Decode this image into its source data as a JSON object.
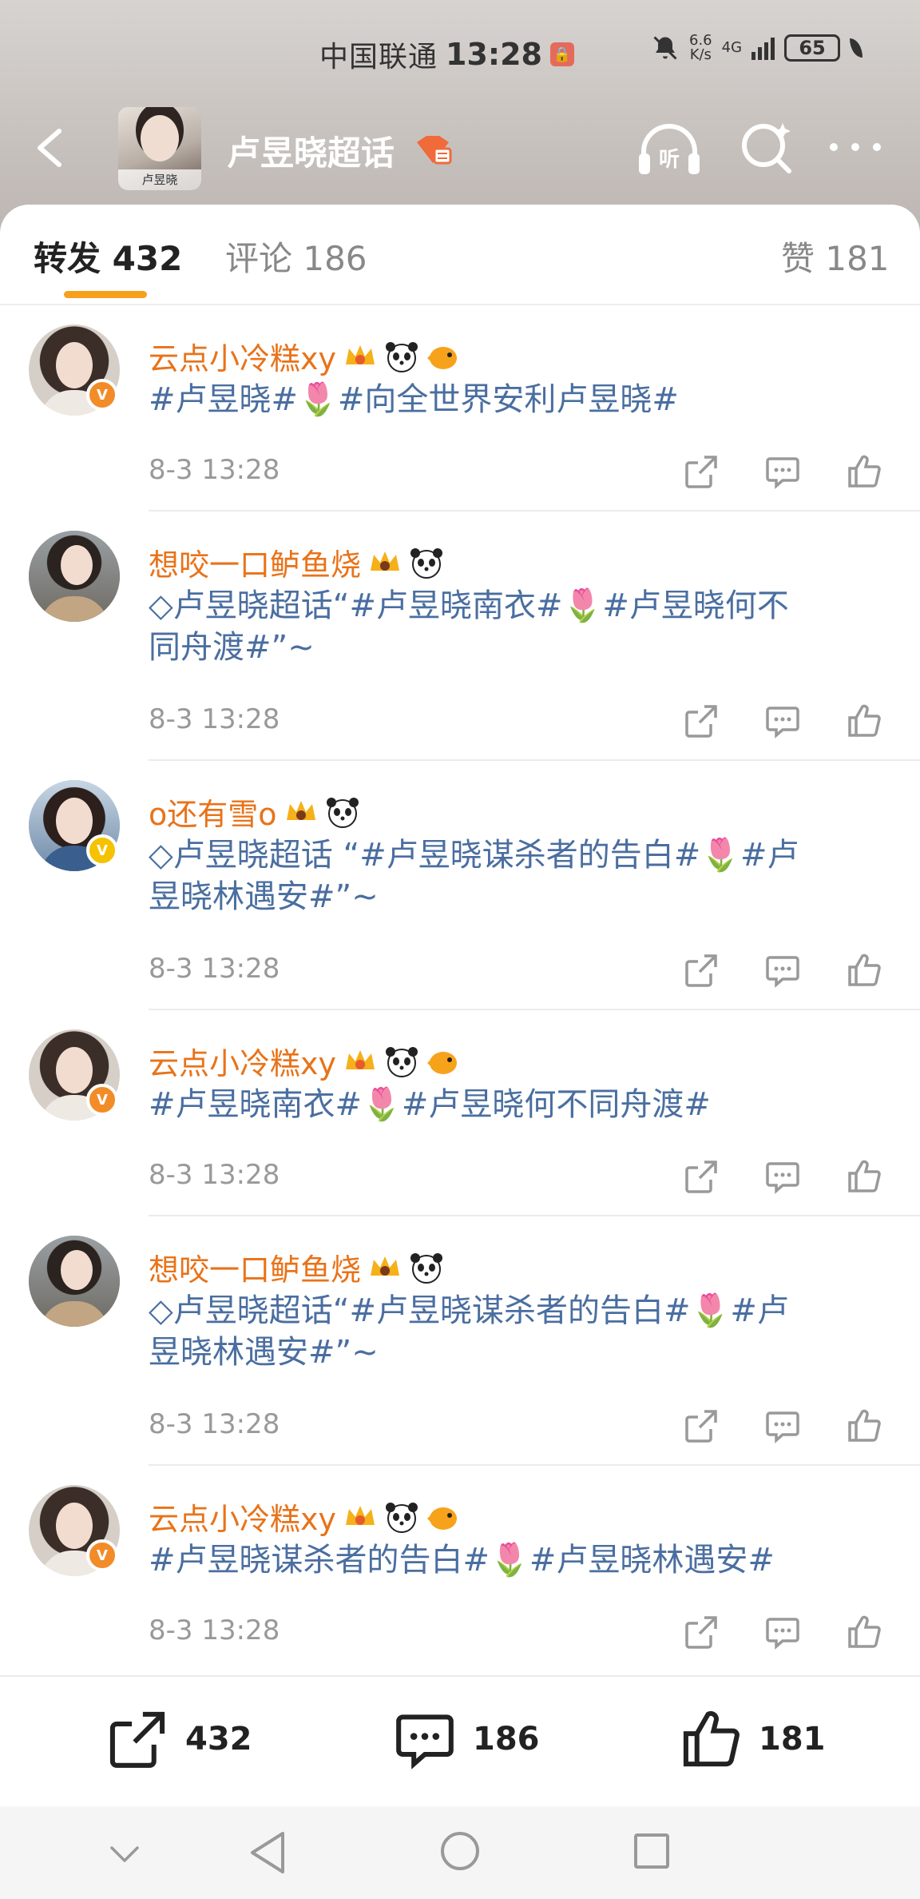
{
  "status": {
    "carrier": "中国联通",
    "time": "13:28",
    "speed_top": "6.6",
    "speed_bottom": "K/s",
    "network": "4G",
    "battery": "65"
  },
  "header": {
    "title": "卢昱晓超话",
    "avatar_caption": "卢昱晓"
  },
  "tabs": [
    {
      "label": "转发 432"
    },
    {
      "label": "评论 186"
    },
    {
      "label": "赞 181"
    }
  ],
  "posts": [
    {
      "user": "云点小冷糕xy",
      "verified": "orange",
      "lines": [
        "#卢昱晓#🌷#向全世界安利卢昱晓#"
      ],
      "time": "8-3 13:28"
    },
    {
      "user": "想咬一口鲈鱼烧",
      "verified": "none",
      "lines": [
        "◇卢昱晓超话“#卢昱晓南衣#🌷#卢昱晓何不",
        "同舟渡#”~"
      ],
      "time": "8-3 13:28"
    },
    {
      "user": "o还有雪o",
      "verified": "yellow",
      "lines": [
        "◇卢昱晓超话 “#卢昱晓谋杀者的告白#🌷#卢",
        "昱晓林遇安#”~"
      ],
      "time": "8-3 13:28"
    },
    {
      "user": "云点小冷糕xy",
      "verified": "orange",
      "lines": [
        "#卢昱晓南衣#🌷#卢昱晓何不同舟渡#"
      ],
      "time": "8-3 13:28"
    },
    {
      "user": "想咬一口鲈鱼烧",
      "verified": "none",
      "lines": [
        "◇卢昱晓超话“#卢昱晓谋杀者的告白#🌷#卢",
        "昱晓林遇安#”~"
      ],
      "time": "8-3 13:28"
    },
    {
      "user": "云点小冷糕xy",
      "verified": "orange",
      "lines": [
        "#卢昱晓谋杀者的告白#🌷#卢昱晓林遇安#"
      ],
      "time": "8-3 13:28"
    }
  ],
  "bottom": {
    "repost_count": "432",
    "comment_count": "186",
    "like_count": "181"
  },
  "colors": {
    "accent": "#f7a01c",
    "username": "#e8731a",
    "topic": "#4a6ea0"
  }
}
